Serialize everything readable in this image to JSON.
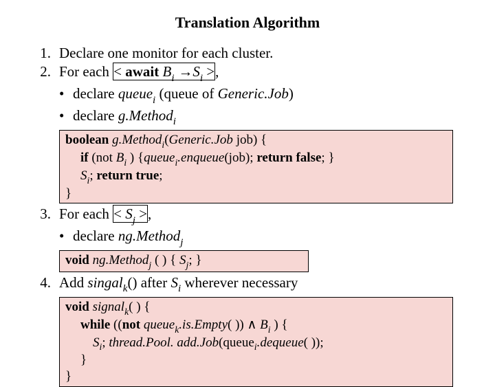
{
  "title": "Translation Algorithm",
  "items": {
    "n1": "1.",
    "t1": "Declare one monitor for each cluster.",
    "n2": "2.",
    "t2a": "For each ",
    "t2box_a": "< ",
    "t2box_await": "await",
    "t2box_b": " B",
    "t2box_sub_i": "i",
    "t2box_arrow": " →",
    "t2box_s": "S",
    "t2box_sub_i2": "i",
    "t2box_c": " >",
    "t2c": ",",
    "b2_1a": "declare ",
    "b2_1b": "queue",
    "b2_1sub": "i",
    "b2_1c": " (queue of ",
    "b2_1d": "Generic.Job",
    "b2_1e": ")",
    "b2_2a": "declare ",
    "b2_2b": "g.Method",
    "b2_2sub": "i",
    "code1_l1a": "boolean",
    "code1_l1b": " g.Method",
    "code1_l1sub": "i",
    "code1_l1c": "(",
    "code1_l1d": "Generic.Job",
    "code1_l1e": " job) {",
    "code1_l2a": "if",
    "code1_l2b": "  (not ",
    "code1_l2c": "B",
    "code1_l2sub": "i",
    "code1_l2d": " ) {",
    "code1_l2e": "queue",
    "code1_l2sub2": "i",
    "code1_l2f": ".enqueue",
    "code1_l2g": "(job); ",
    "code1_l2h": "return false",
    "code1_l2i": "; }",
    "code1_l3a": "S",
    "code1_l3sub": "i",
    "code1_l3b": "; ",
    "code1_l3c": "return true",
    "code1_l3d": ";",
    "code1_l4": "}",
    "n3": "3.",
    "t3a": "For each ",
    "t3box_a": "< ",
    "t3box_s": "S",
    "t3box_sub": "j",
    "t3box_b": " >",
    "t3c": ",",
    "b3_1a": "declare ",
    "b3_1b": "ng.Method",
    "b3_1sub": "j",
    "code2_l1a": "void",
    "code2_l1b": " ng.Method",
    "code2_l1sub": "j",
    "code2_l1c": " ( ) { ",
    "code2_l1d": "S",
    "code2_l1sub2": "j",
    "code2_l1e": "; }",
    "n4": "4.",
    "t4a": "Add ",
    "t4b": "singal",
    "t4sub": "k",
    "t4c": "() after ",
    "t4d": "S",
    "t4sub2": "i",
    "t4e": " wherever necessary",
    "code3_l1a": "void",
    "code3_l1b": " signal",
    "code3_l1sub": "k",
    "code3_l1c": "( ) {",
    "code3_l2a": "while",
    "code3_l2b": " ((",
    "code3_l2c": "not",
    "code3_l2d": " queue",
    "code3_l2sub": "k",
    "code3_l2e": ".is.Empty",
    "code3_l2f": "( )) ",
    "code3_l2wedge": "∧",
    "code3_l2g": " B",
    "code3_l2sub2": "i",
    "code3_l2h": " ) {",
    "code3_l3a": "S",
    "code3_l3sub": "i",
    "code3_l3b": "; ",
    "code3_l3c": "thread.Pool. add.Job",
    "code3_l3d": "(queue",
    "code3_l3sub2": "i",
    "code3_l3e": ".dequeue",
    "code3_l3f": "( ));",
    "code3_l4": "}",
    "code3_l5": "}"
  }
}
